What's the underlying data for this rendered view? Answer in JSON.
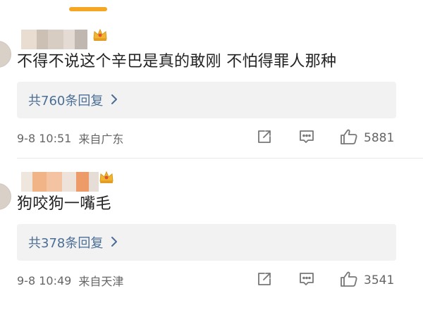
{
  "accent_color": "#f5a623",
  "reply_link_color": "#4b6e96",
  "comments": [
    {
      "text": "不得不说这个辛巴是真的敢刚 不怕得罪人那种",
      "reply_summary": "共760条回复",
      "time": "9-8 10:51",
      "location": "来自广东",
      "likes": "5881",
      "icons": {
        "badge": "crown-icon",
        "repost": "share-icon",
        "comment": "comment-icon",
        "like": "thumbs-up-icon"
      }
    },
    {
      "text": "狗咬狗一嘴毛",
      "reply_summary": "共378条回复",
      "time": "9-8 10:49",
      "location": "来自天津",
      "likes": "3541",
      "icons": {
        "badge": "crown-icon",
        "repost": "share-icon",
        "comment": "comment-icon",
        "like": "thumbs-up-icon"
      }
    }
  ]
}
